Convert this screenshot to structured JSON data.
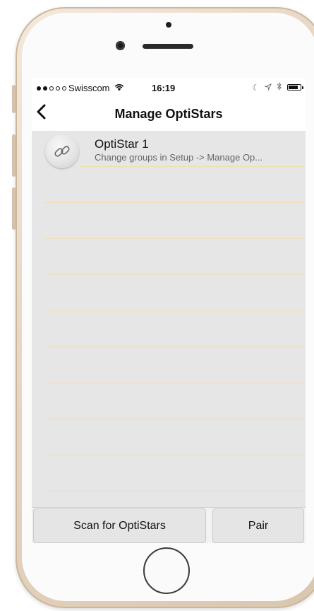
{
  "status_bar": {
    "carrier": "Swisscom",
    "time": "16:19",
    "wifi_icon": "wifi-icon",
    "battery_level": 0.8
  },
  "nav": {
    "back_icon": "chevron-left-icon",
    "title": "Manage OptiStars"
  },
  "devices": [
    {
      "icon": "link-icon",
      "name": "OptiStar 1",
      "subtitle": "Change groups in Setup -> Manage Op..."
    }
  ],
  "buttons": {
    "scan": "Scan for OptiStars",
    "pair": "Pair"
  },
  "colors": {
    "separator": "#f1ddb4",
    "list_background": "#e6e6e6",
    "frame": "#e6d6c2"
  }
}
